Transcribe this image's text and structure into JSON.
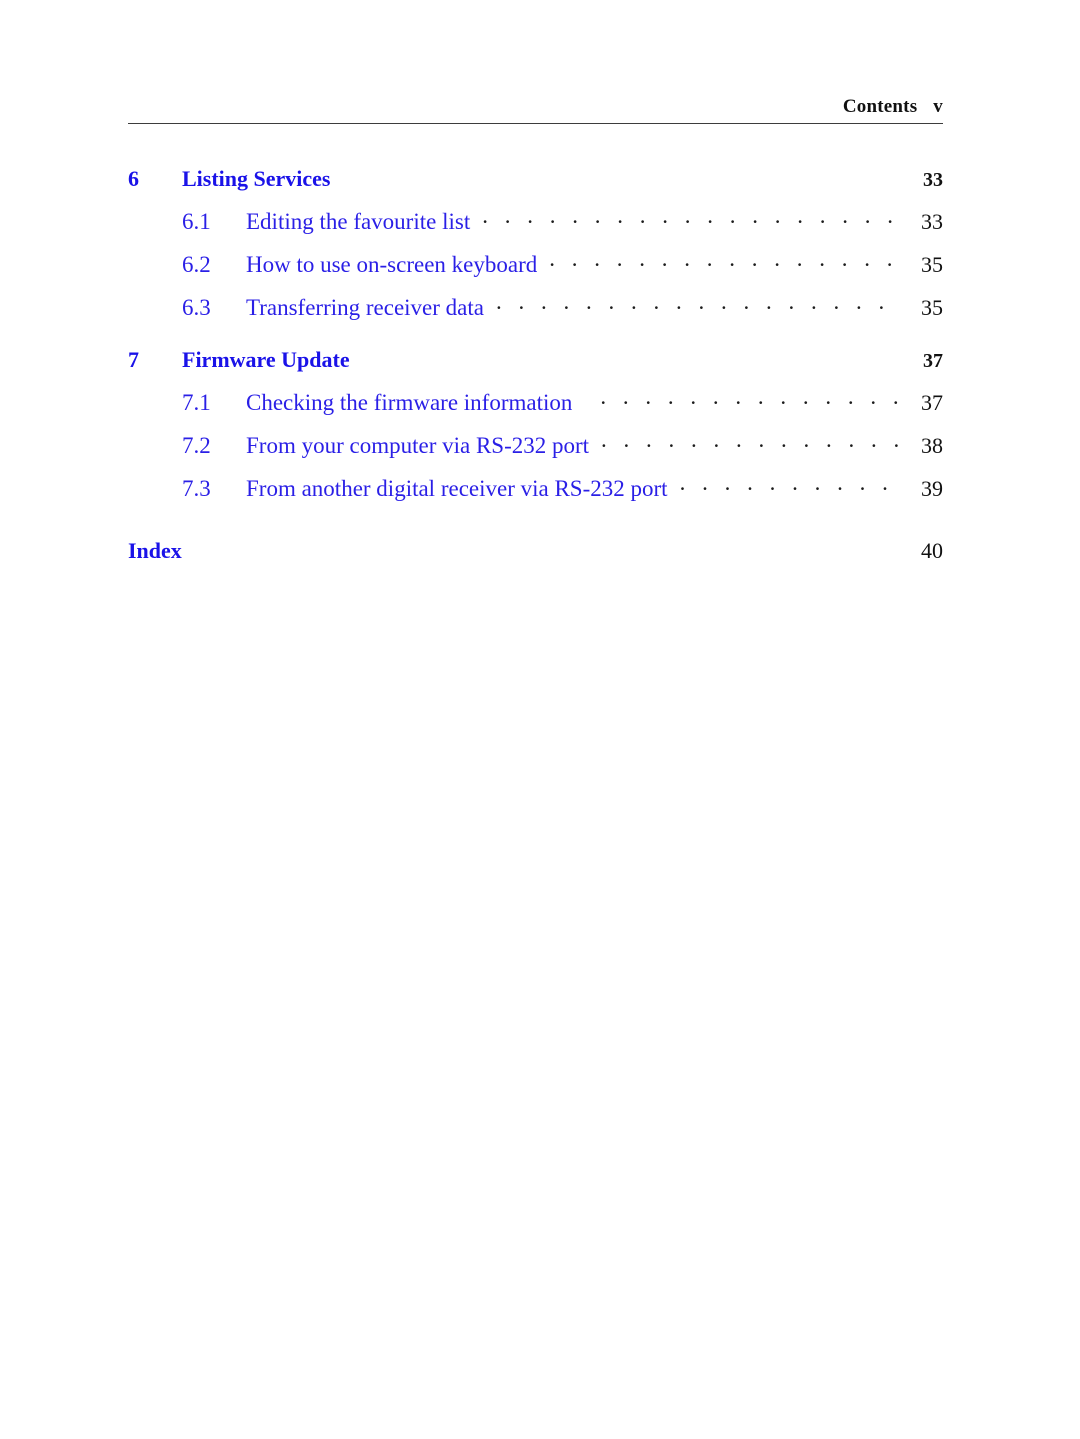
{
  "header": {
    "title": "Contents",
    "folio": "v"
  },
  "toc": {
    "groups": [
      {
        "chapter": {
          "number": "6",
          "title": "Listing Services",
          "page": "33"
        },
        "sections": [
          {
            "number": "6.1",
            "title": "Editing the favourite list",
            "page": "33"
          },
          {
            "number": "6.2",
            "title": "How to use on-screen keyboard",
            "page": "35"
          },
          {
            "number": "6.3",
            "title": "Transferring receiver data",
            "page": "35"
          }
        ]
      },
      {
        "chapter": {
          "number": "7",
          "title": "Firmware Update",
          "page": "37"
        },
        "sections": [
          {
            "number": "7.1",
            "title": "Checking the firmware information",
            "page": "37"
          },
          {
            "number": "7.2",
            "title": "From your computer via RS-232 port",
            "page": "38"
          },
          {
            "number": "7.3",
            "title": "From another digital receiver via RS-232 port",
            "page": "39"
          }
        ]
      }
    ],
    "backmatter": [
      {
        "title": "Index",
        "page": "40"
      }
    ]
  },
  "colors": {
    "link_blue": "#1a12e8",
    "text_black": "#111111",
    "rule_gray": "#3d3d3d",
    "background": "#ffffff"
  }
}
